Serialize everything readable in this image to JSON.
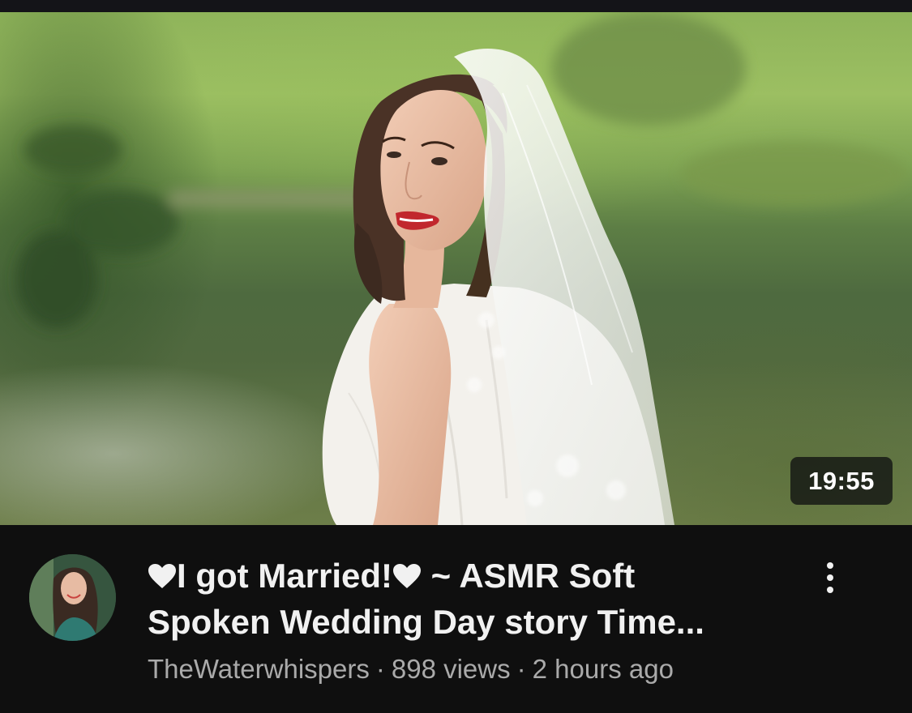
{
  "video": {
    "duration": "19:55",
    "title_line1_text": "I got Married!",
    "title_line1_suffix": " ~ ASMR Soft",
    "title_line2": "Spoken Wedding Day story Time..."
  },
  "meta": {
    "channel": "TheWaterwhispers",
    "separator": "·",
    "views": "898 views",
    "age": "2 hours ago"
  },
  "icons": {
    "heart": "heart-icon",
    "menu": "more-vert-icon"
  },
  "colors": {
    "background": "#0f0f0f",
    "title": "#f1f1f1",
    "meta": "#aaaaaa",
    "badge_bg": "#141614",
    "lips": "#c1272d"
  }
}
